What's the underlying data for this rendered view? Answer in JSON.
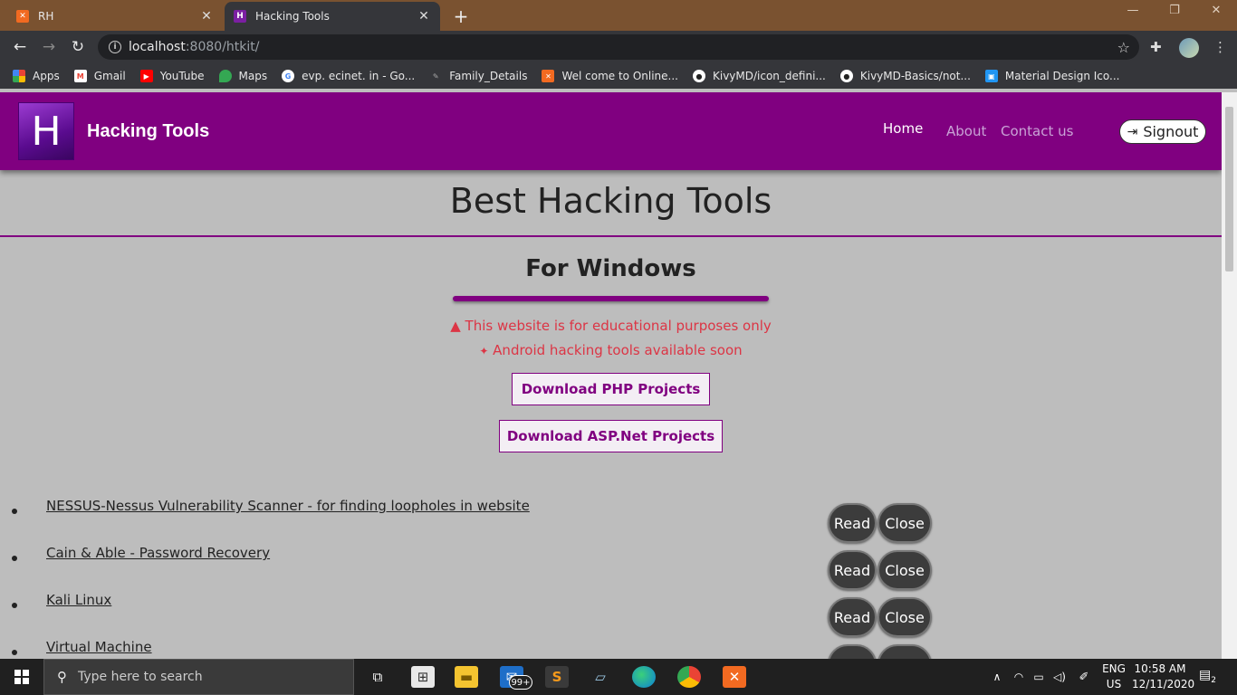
{
  "browser": {
    "tabs": [
      {
        "title": "RH",
        "favicon": "xampp-icon",
        "favicon_color": "#f26a21"
      },
      {
        "title": "Hacking Tools",
        "favicon": "h-icon",
        "favicon_color": "#7b1fa2"
      }
    ],
    "url_host": "localhost",
    "url_rest": ":8080/htkit/",
    "bookmarks": [
      {
        "label": "Apps",
        "icon": "apps-grid-icon",
        "color": "#4285f4"
      },
      {
        "label": "Gmail",
        "icon": "gmail-icon",
        "color": "#ea4335"
      },
      {
        "label": "YouTube",
        "icon": "youtube-icon",
        "color": "#ff0000"
      },
      {
        "label": "Maps",
        "icon": "maps-pin-icon",
        "color": "#34a853"
      },
      {
        "label": "evp. ecinet. in - Go...",
        "icon": "google-icon",
        "color": "#ffffff"
      },
      {
        "label": "Family_Details",
        "icon": "pen-icon",
        "color": "#888888"
      },
      {
        "label": "Wel come to Online...",
        "icon": "xampp-icon",
        "color": "#f26a21"
      },
      {
        "label": "KivyMD/icon_defini...",
        "icon": "github-icon",
        "color": "#ffffff"
      },
      {
        "label": "KivyMD-Basics/not...",
        "icon": "github-icon",
        "color": "#ffffff"
      },
      {
        "label": "Material Design Ico...",
        "icon": "material-icon",
        "color": "#2196f3"
      }
    ]
  },
  "site": {
    "brand": "Hacking Tools",
    "logo_letter": "H",
    "nav": {
      "home": "Home",
      "about": "About",
      "contact": "Contact us",
      "signout": "Signout"
    },
    "title": "Best Hacking Tools",
    "section": "For Windows",
    "warning_1": "This website is for educational purposes only",
    "warning_2": "Android hacking tools available soon",
    "download_php": "Download PHP Projects",
    "download_asp": "Download ASP.Net Projects",
    "read_label": "Read",
    "close_label": "Close",
    "tools": [
      "NESSUS-Nessus Vulnerability Scanner - for finding loopholes in website",
      "Cain & Able - Password Recovery",
      "Kali Linux",
      "Virtual Machine"
    ],
    "accent_color": "#800080",
    "warning_color": "#dc3545"
  },
  "taskbar": {
    "search_placeholder": "Type here to search",
    "mail_badge": "99+",
    "lang_1": "ENG",
    "lang_2": "US",
    "time": "10:58 AM",
    "date": "12/11/2020",
    "notification_count": "2"
  }
}
